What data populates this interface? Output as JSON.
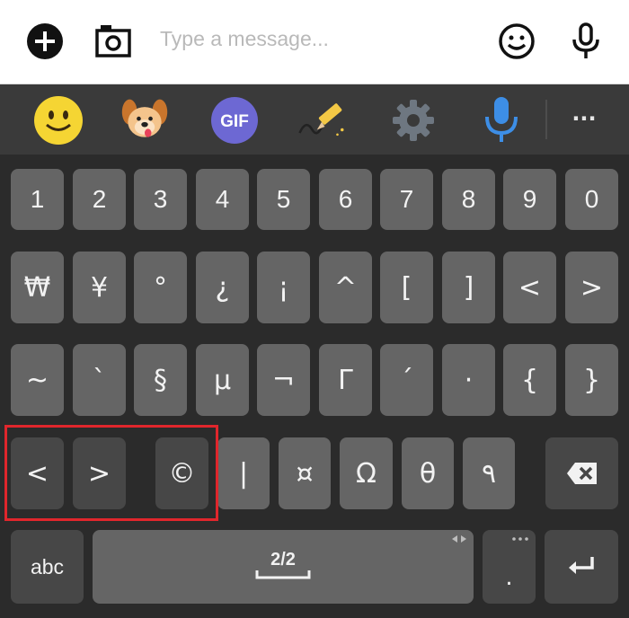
{
  "compose": {
    "placeholder": "Type a message..."
  },
  "toolbar": {
    "gif_label": "GIF",
    "more_label": "···"
  },
  "keyboard": {
    "row1": [
      "1",
      "2",
      "3",
      "4",
      "5",
      "6",
      "7",
      "8",
      "9",
      "0"
    ],
    "row2": [
      "₩",
      "¥",
      "°",
      "¿",
      "¡",
      "^",
      "[",
      "]",
      "<",
      ">"
    ],
    "row3": [
      "~",
      "`",
      "§",
      "µ",
      "¬",
      "Γ",
      "´",
      "·",
      "{",
      "}"
    ],
    "row4": [
      "<",
      ">",
      "©",
      "|",
      "¤",
      "Ω",
      "θ",
      "٩"
    ],
    "abc_label": "abc",
    "page_indicator": "2/2",
    "period_label": ".",
    "enter_symbol": "↵"
  },
  "colors": {
    "highlight": "#e0262c",
    "key": "#656565",
    "key_dark": "#474747",
    "background": "#2b2b2b"
  }
}
